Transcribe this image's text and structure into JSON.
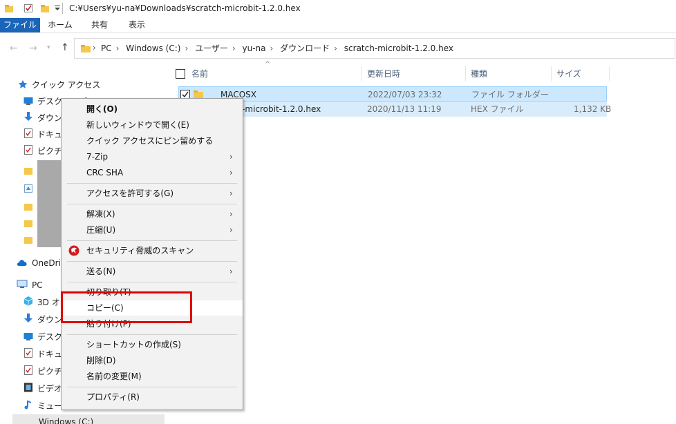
{
  "titlebar": {
    "path": "C:¥Users¥yu-na¥Downloads¥scratch-microbit-1.2.0.hex",
    "icons": [
      "folder-icon",
      "checkbox-icon",
      "folder-icon",
      "dropdown-icon"
    ]
  },
  "ribbon": {
    "tabs": [
      "ファイル",
      "ホーム",
      "共有",
      "表示"
    ]
  },
  "address": {
    "crumbs": [
      "PC",
      "Windows (C:)",
      "ユーザー",
      "yu-na",
      "ダウンロード",
      "scratch-microbit-1.2.0.hex"
    ]
  },
  "sidebar": {
    "quick_access": "クイック アクセス",
    "items": [
      "デスクトップ",
      "ダウンロード",
      "ドキュメント",
      "ピクチャ"
    ],
    "onedrive": "OneDrive",
    "pc": "PC",
    "pc_items": [
      "3D オブジェクト",
      "ダウンロード",
      "デスクトップ",
      "ドキュメント",
      "ピクチャ",
      "ビデオ",
      "ミュージック"
    ],
    "drive": "Windows (C:)"
  },
  "filelist": {
    "columns": [
      "名前",
      "更新日時",
      "種類",
      "サイズ"
    ],
    "rows": [
      {
        "name": "__MACOSX",
        "date": "2022/07/03 23:32",
        "type": "ファイル フォルダー",
        "size": ""
      },
      {
        "name": "scratch-microbit-1.2.0.hex",
        "date": "2020/11/13 11:19",
        "type": "HEX ファイル",
        "size": "1,132 KB"
      }
    ]
  },
  "menu": {
    "open": "開く(O)",
    "open_new_window": "新しいウィンドウで開く(E)",
    "pin_quick_access": "クイック アクセスにピン留めする",
    "seven_zip": "7-Zip",
    "crc_sha": "CRC SHA",
    "grant_access": "アクセスを許可する(G)",
    "extract": "解凍(X)",
    "compress": "圧縮(U)",
    "security_scan": "セキュリティ脅威のスキャン",
    "send_to": "送る(N)",
    "cut": "切り取り(T)",
    "copy": "コピー(C)",
    "paste": "貼り付け(P)",
    "create_shortcut": "ショートカットの作成(S)",
    "delete": "削除(D)",
    "rename": "名前の変更(M)",
    "properties": "プロパティ(R)",
    "arrow": "›"
  },
  "colors": {
    "accent": "#1a65b8",
    "selection": "#cce8ff",
    "highlight_box": "#e00000",
    "folder": "#f4c84a"
  }
}
